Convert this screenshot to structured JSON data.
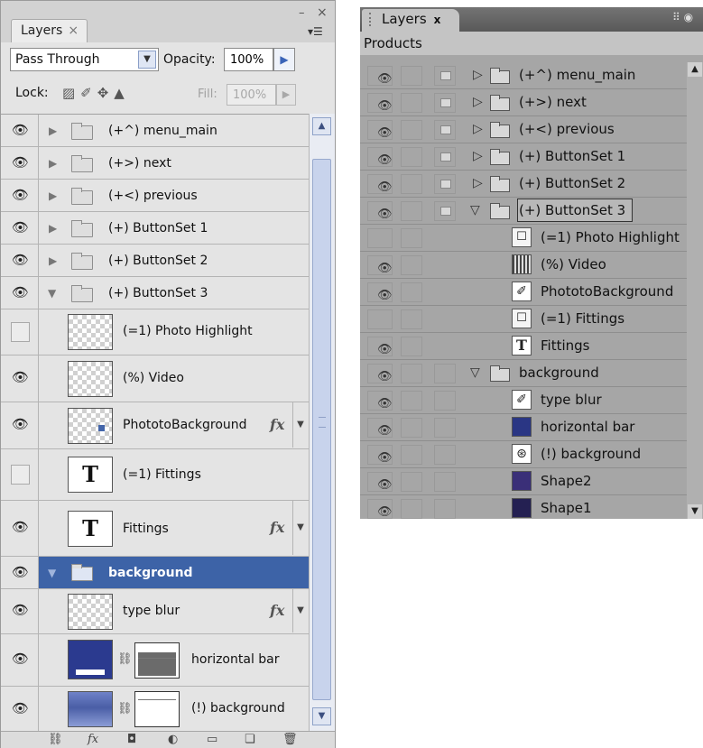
{
  "left_panel": {
    "tab_label": "Layers",
    "tab_close": "×",
    "minimize": "–",
    "close": "×",
    "menu": "▾☰",
    "blend_mode": "Pass Through",
    "opacity_label": "Opacity:",
    "opacity_value": "100%",
    "lock_label": "Lock:",
    "lock_icons": "▨✐✥▲",
    "fill_label": "Fill:",
    "fill_value": "100%",
    "layers": [
      {
        "name": "(+^) menu_main",
        "visible": true,
        "type": "group-collapsed"
      },
      {
        "name": "(+>) next",
        "visible": true,
        "type": "group-collapsed"
      },
      {
        "name": "(+<) previous",
        "visible": true,
        "type": "group-collapsed"
      },
      {
        "name": "(+) ButtonSet 1",
        "visible": true,
        "type": "group-collapsed"
      },
      {
        "name": "(+) ButtonSet 2",
        "visible": true,
        "type": "group-collapsed"
      },
      {
        "name": "(+) ButtonSet 3",
        "visible": true,
        "type": "group-expanded"
      },
      {
        "name": "(=1) Photo Highlight",
        "visible": false,
        "type": "layer"
      },
      {
        "name": "(%) Video",
        "visible": true,
        "type": "layer"
      },
      {
        "name": "PhototoBackground",
        "visible": true,
        "type": "layer",
        "fx": "fx"
      },
      {
        "name": "(=1) Fittings",
        "visible": false,
        "type": "text"
      },
      {
        "name": "Fittings",
        "visible": true,
        "type": "text",
        "fx": "fx"
      },
      {
        "name": "background",
        "visible": true,
        "type": "group-expanded",
        "selected": true
      },
      {
        "name": "type blur",
        "visible": true,
        "type": "layer",
        "fx": "fx"
      },
      {
        "name": "horizontal bar",
        "visible": true,
        "type": "masked"
      },
      {
        "name": "(!) background",
        "visible": true,
        "type": "masked"
      }
    ],
    "text_thumb_glyph": "T",
    "chain_glyph": "⛓",
    "fx_arrow": "▼",
    "bottom_icons": [
      "⛓",
      "fx",
      "◘",
      "◐",
      "▭",
      "❏",
      "🗑"
    ]
  },
  "right_panel": {
    "tab_label": "Layers",
    "tab_close": "x",
    "context_label": "Products",
    "layers": [
      {
        "name": "(+^) menu_main",
        "visible": true,
        "type": "group-collapsed"
      },
      {
        "name": "(+>) next",
        "visible": true,
        "type": "group-collapsed"
      },
      {
        "name": "(+<) previous",
        "visible": true,
        "type": "group-collapsed"
      },
      {
        "name": "(+) ButtonSet 1",
        "visible": true,
        "type": "group-collapsed"
      },
      {
        "name": "(+) ButtonSet 2",
        "visible": true,
        "type": "group-collapsed"
      },
      {
        "name": "(+) ButtonSet 3",
        "visible": true,
        "type": "group-expanded",
        "selected": true
      },
      {
        "name": "(=1) Photo Highlight",
        "visible": false,
        "type": "layer"
      },
      {
        "name": "(%) Video",
        "visible": true,
        "type": "layer"
      },
      {
        "name": "PhototoBackground",
        "visible": true,
        "type": "layer"
      },
      {
        "name": "(=1) Fittings",
        "visible": false,
        "type": "layer"
      },
      {
        "name": "Fittings",
        "visible": true,
        "type": "text"
      },
      {
        "name": "background",
        "visible": true,
        "type": "group-expanded"
      },
      {
        "name": "type blur",
        "visible": true,
        "type": "layer"
      },
      {
        "name": "horizontal bar",
        "visible": true,
        "type": "layer"
      },
      {
        "name": "(!) background",
        "visible": true,
        "type": "layer"
      },
      {
        "name": "Shape2",
        "visible": true,
        "type": "layer"
      },
      {
        "name": "Shape1",
        "visible": true,
        "type": "layer"
      }
    ]
  },
  "colors": {
    "selection_blue": "#3d63a7",
    "navy_swatch": "#2a3684",
    "violet_swatch": "#3a2f78",
    "dark_swatch": "#242052"
  }
}
